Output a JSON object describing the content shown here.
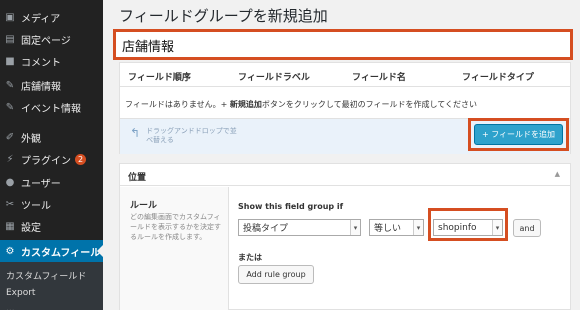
{
  "sidebar": {
    "items": [
      {
        "label": "メディア",
        "icon": "media-icon"
      },
      {
        "label": "固定ページ",
        "icon": "page-icon"
      },
      {
        "label": "コメント",
        "icon": "comment-icon"
      },
      {
        "label": "店舗情報",
        "icon": "pin-icon"
      },
      {
        "label": "イベント情報",
        "icon": "pin-icon"
      },
      {
        "label": "外観",
        "icon": "brush-icon"
      },
      {
        "label": "プラグイン",
        "icon": "plugin-icon",
        "badge": "2"
      },
      {
        "label": "ユーザー",
        "icon": "user-icon"
      },
      {
        "label": "ツール",
        "icon": "wrench-icon"
      },
      {
        "label": "設定",
        "icon": "settings-icon"
      },
      {
        "label": "カスタムフィール",
        "icon": "gear-icon",
        "active": true
      }
    ],
    "submenu": [
      "カスタムフィールド",
      "Export",
      "..."
    ]
  },
  "page": {
    "title": "フィールドグループを新規追加",
    "group_title_value": "店舗情報"
  },
  "fields_table": {
    "columns": [
      "フィールド順序",
      "フィールドラベル",
      "フィールド名",
      "フィールドタイプ"
    ],
    "empty_prefix": "フィールドはありません。+ ",
    "empty_bold": "新規追加",
    "empty_suffix": "ボタンをクリックして最初のフィールドを作成してください",
    "drag_hint_line1": "ドラッグアンドドロップで並",
    "drag_hint_line2": "べ替える",
    "add_field_button": "+ フィールドを追加"
  },
  "location": {
    "title": "位置",
    "collapse_icon": "triangle-up-icon",
    "rule_label": "ルール",
    "rule_description": "どの編集画面でカスタムフィールドを表示するかを決定するルールを作成します。",
    "show_if_label": "Show this field group if",
    "param_select": "投稿タイプ",
    "operator_select": "等しい",
    "value_select": "shopinfo",
    "and_button": "and",
    "or_label": "または",
    "add_rule_group_button": "Add rule group"
  },
  "colors": {
    "sidebar_bg": "#222222",
    "active_menu": "#0073aa",
    "highlight_border": "#d54e21",
    "primary_button": "#2ea2cc"
  }
}
